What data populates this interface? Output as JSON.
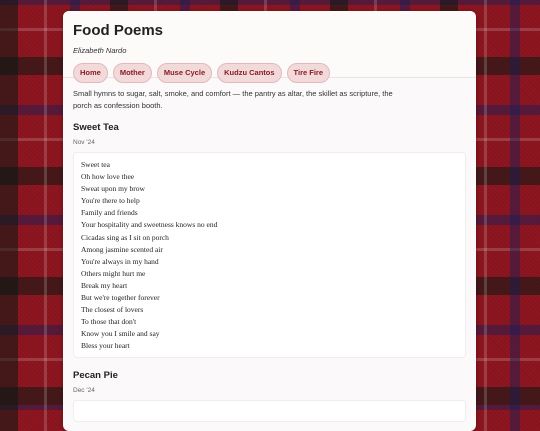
{
  "site": {
    "title": "Food Poems",
    "author": "Elizabeth Nardo"
  },
  "nav": [
    "Home",
    "Mother",
    "Muse Cycle",
    "Kudzu Cantos",
    "Tire Fire"
  ],
  "intro": "Small hymns to sugar, salt, smoke, and comfort — the pantry as altar, the skillet as scripture, the porch as confession booth.",
  "poems": [
    {
      "title": "Sweet Tea",
      "date": "Nov '24",
      "lines": [
        "Sweet tea",
        "Oh how love thee",
        "Sweat upon my brow",
        "You're there to help",
        "Family and friends",
        "Your hospitality and sweetness knows no end",
        "Cicadas sing as I sit on porch",
        "Among jasmine scented air",
        "You're always in my hand",
        "Others might hurt me",
        "Break my heart",
        "But we're together forever",
        "The closest of lovers",
        "To those that don't",
        "Know you I smile and say",
        "Bless your heart"
      ]
    },
    {
      "title": "Pecan Pie",
      "date": "Dec '24"
    }
  ],
  "colors": {
    "accent": "#8a1a24",
    "pill_bg": "#f3dada",
    "background_plaid": "#8e1620"
  }
}
